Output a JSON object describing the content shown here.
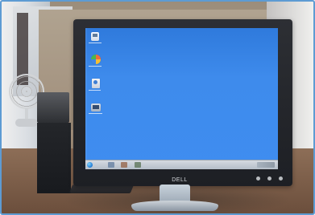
{
  "photo": {
    "subject": "desktop-monitor",
    "brand": "DELL"
  },
  "screen": {
    "desktop_background": "#3f8df0",
    "taskbar": "#c7ced8",
    "icons": [
      "computer-icon",
      "browser-icon",
      "document-icon",
      "media-icon"
    ]
  },
  "environment": {
    "desk": "#7b5a44",
    "frame_border": "#5d9bd3",
    "monitor_frame": "#25272c"
  }
}
